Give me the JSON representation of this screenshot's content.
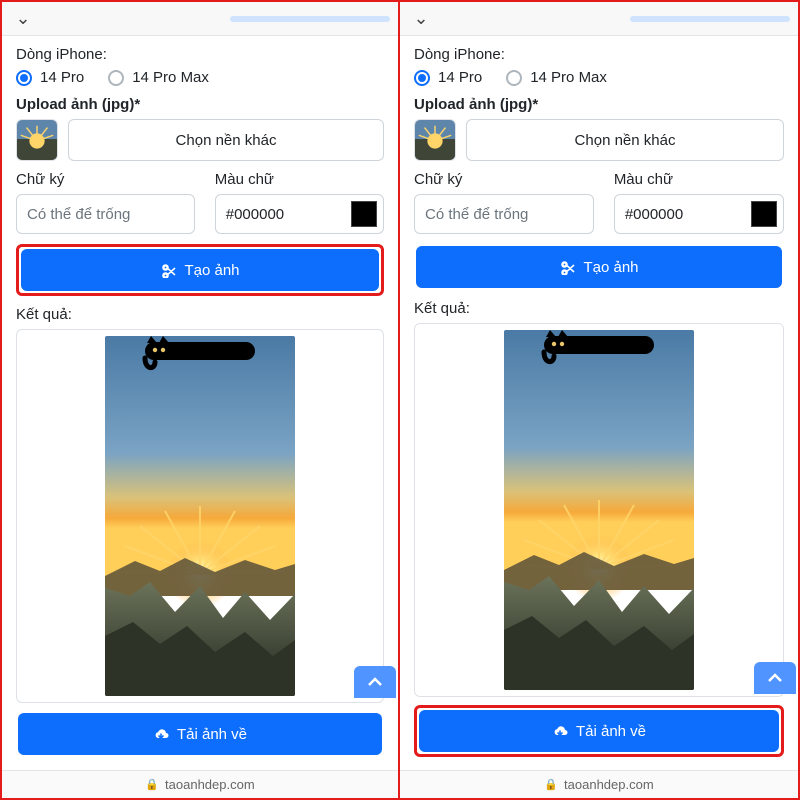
{
  "url_domain": "taoanhdep.com",
  "labels": {
    "line_label": "Dòng iPhone:",
    "upload_label": "Upload ảnh (jpg)*",
    "choose_bg": "Chọn nền khác",
    "sig_label": "Chữ ký",
    "sig_placeholder": "Có thể để trống",
    "color_label": "Màu chữ",
    "color_value": "#000000",
    "generate": "Tạo ảnh",
    "result_label": "Kết quả:",
    "download": "Tải ảnh về"
  },
  "radios": {
    "opt1": "14 Pro",
    "opt2": "14 Pro Max",
    "selected": "14 Pro"
  },
  "panels": [
    {
      "highlight_generate": true,
      "highlight_download": false
    },
    {
      "highlight_generate": false,
      "highlight_download": true
    }
  ]
}
